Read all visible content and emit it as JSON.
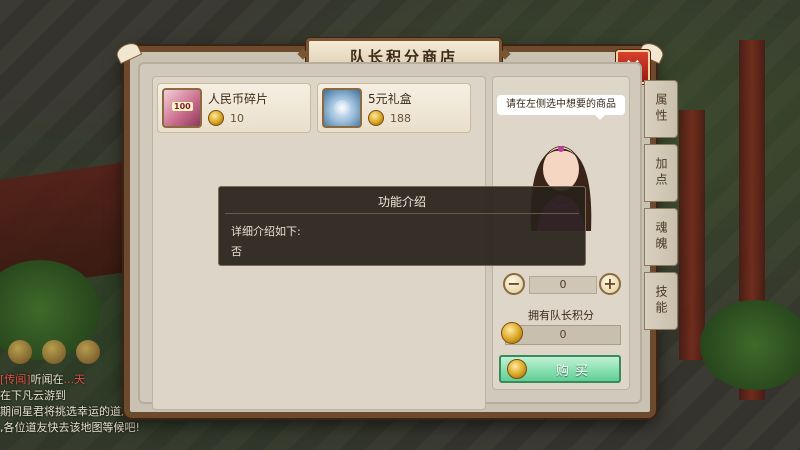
{
  "shop": {
    "title": "队长积分商店",
    "close_label": "✕",
    "items": [
      {
        "name": "人民币碎片",
        "price": "10",
        "thumb_label": "100"
      },
      {
        "name": "5元礼盒",
        "price": "188"
      }
    ],
    "detail": {
      "prompt": "请在左侧选中想要的商品",
      "quantity": "0",
      "points_label": "拥有队长积分",
      "points_value": "0",
      "buy_label": "购买"
    },
    "side_tabs": [
      "属性",
      "加点",
      "魂魄",
      "技能"
    ]
  },
  "popup": {
    "title": "功能介绍",
    "line1": "详细介绍如下:",
    "line2": "否"
  },
  "chat": {
    "lines": [
      {
        "channel": "[传闻]",
        "text": "听闻在",
        "extra": "...天"
      },
      {
        "channel": "",
        "text": "在",
        "extra": "下凡云游到"
      },
      {
        "channel": "",
        "text": "期间星君将挑选幸运的道友进行指点",
        "extra": ""
      },
      {
        "channel": "",
        "text": ",各位道友快去该地图等候吧!",
        "extra": ""
      }
    ]
  },
  "colors": {
    "panel_border": "#6b4a2e",
    "close_red": "#c0301f",
    "buy_green": "#5fcf95"
  }
}
